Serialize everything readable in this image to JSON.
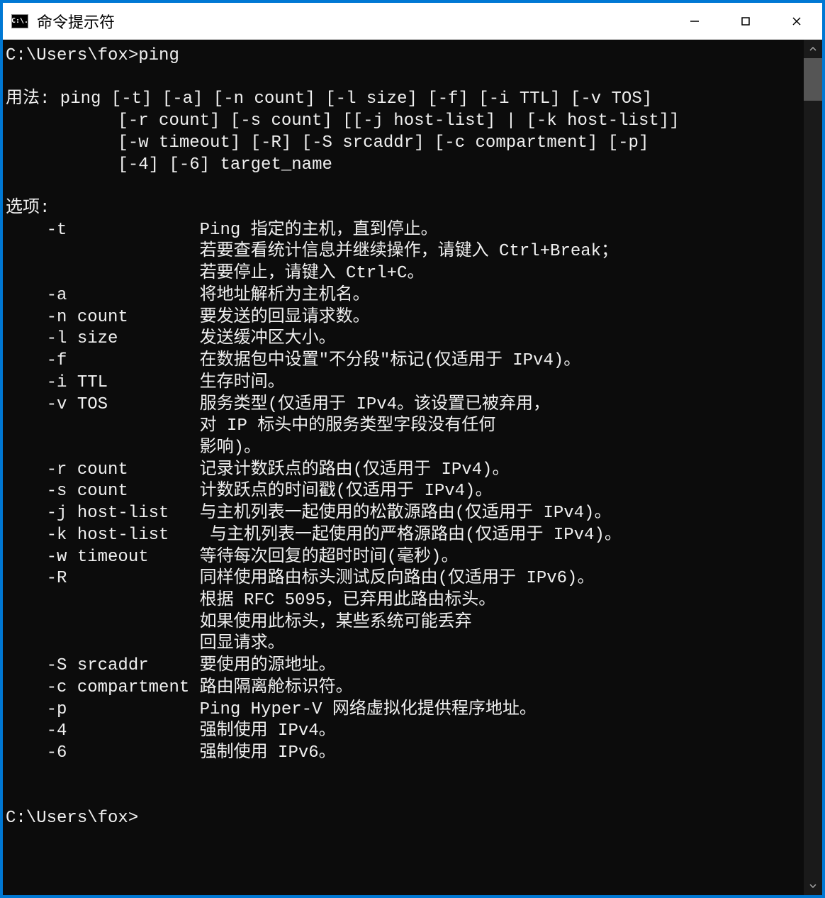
{
  "window": {
    "icon_text": "C:\\.",
    "title": "命令提示符"
  },
  "terminal": {
    "prompt1": "C:\\Users\\fox>ping",
    "blank1": "",
    "usage_label": "用法:",
    "usage_line1": " ping [-t] [-a] [-n count] [-l size] [-f] [-i TTL] [-v TOS]",
    "usage_line2": "           [-r count] [-s count] [[-j host-list] | [-k host-list]]",
    "usage_line3": "           [-w timeout] [-R] [-S srcaddr] [-c compartment] [-p]",
    "usage_line4": "           [-4] [-6] target_name",
    "blank2": "",
    "options_label": "选项:",
    "opt_rows": [
      {
        "flag": "    -t             ",
        "desc": "Ping 指定的主机，直到停止。"
      },
      {
        "flag": "                   ",
        "desc": "若要查看统计信息并继续操作，请键入 Ctrl+Break；"
      },
      {
        "flag": "                   ",
        "desc": "若要停止，请键入 Ctrl+C。"
      },
      {
        "flag": "    -a             ",
        "desc": "将地址解析为主机名。"
      },
      {
        "flag": "    -n count       ",
        "desc": "要发送的回显请求数。"
      },
      {
        "flag": "    -l size        ",
        "desc": "发送缓冲区大小。"
      },
      {
        "flag": "    -f             ",
        "desc": "在数据包中设置\"不分段\"标记(仅适用于 IPv4)。"
      },
      {
        "flag": "    -i TTL         ",
        "desc": "生存时间。"
      },
      {
        "flag": "    -v TOS         ",
        "desc": "服务类型(仅适用于 IPv4。该设置已被弃用，"
      },
      {
        "flag": "                   ",
        "desc": "对 IP 标头中的服务类型字段没有任何"
      },
      {
        "flag": "                   ",
        "desc": "影响)。"
      },
      {
        "flag": "    -r count       ",
        "desc": "记录计数跃点的路由(仅适用于 IPv4)。"
      },
      {
        "flag": "    -s count       ",
        "desc": "计数跃点的时间戳(仅适用于 IPv4)。"
      },
      {
        "flag": "    -j host-list   ",
        "desc": "与主机列表一起使用的松散源路由(仅适用于 IPv4)。"
      },
      {
        "flag": "    -k host-list   ",
        "desc": " 与主机列表一起使用的严格源路由(仅适用于 IPv4)。"
      },
      {
        "flag": "    -w timeout     ",
        "desc": "等待每次回复的超时时间(毫秒)。"
      },
      {
        "flag": "    -R             ",
        "desc": "同样使用路由标头测试反向路由(仅适用于 IPv6)。"
      },
      {
        "flag": "                   ",
        "desc": "根据 RFC 5095，已弃用此路由标头。"
      },
      {
        "flag": "                   ",
        "desc": "如果使用此标头，某些系统可能丢弃"
      },
      {
        "flag": "                   ",
        "desc": "回显请求。"
      },
      {
        "flag": "    -S srcaddr     ",
        "desc": "要使用的源地址。"
      },
      {
        "flag": "    -c compartment ",
        "desc": "路由隔离舱标识符。"
      },
      {
        "flag": "    -p             ",
        "desc": "Ping Hyper-V 网络虚拟化提供程序地址。"
      },
      {
        "flag": "    -4             ",
        "desc": "强制使用 IPv4。"
      },
      {
        "flag": "    -6             ",
        "desc": "强制使用 IPv6。"
      }
    ],
    "blank3": "",
    "blank4": "",
    "prompt2": "C:\\Users\\fox>"
  }
}
